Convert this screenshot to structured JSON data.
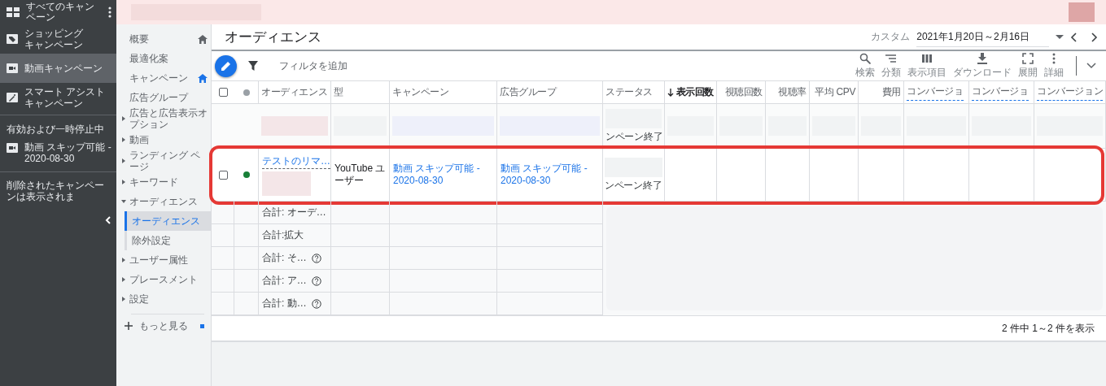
{
  "sidebar": {
    "title": "すべてのキャンペーン",
    "items": [
      {
        "kind": "shopping",
        "lines": [
          "ショッピング",
          "キャンペーン"
        ],
        "selected": false
      },
      {
        "kind": "video",
        "lines": [
          "動画キャンペーン"
        ],
        "selected": true
      },
      {
        "kind": "smart",
        "lines": [
          "スマート アシスト",
          "キャンペーン"
        ],
        "selected": false
      }
    ],
    "section_label": "有効および一時停止中",
    "campaigns": [
      {
        "kind": "video",
        "label": "動画 スキップ可能 - 2020-08-30"
      }
    ],
    "note": "削除されたキャンペーンは表示されま"
  },
  "nav": {
    "items": [
      {
        "label": "概要",
        "home": true,
        "home_active": false,
        "expandable": false
      },
      {
        "label": "最適化案",
        "expandable": false
      },
      {
        "label": "キャンペーン",
        "home": true,
        "home_active": true,
        "expandable": false
      },
      {
        "label": "広告グループ",
        "expandable": false
      },
      {
        "label": "広告と広告表示オプション",
        "expandable": true,
        "expanded": false
      },
      {
        "label": "動画",
        "expandable": true,
        "expanded": false
      },
      {
        "label": "ランディング ページ",
        "expandable": true,
        "expanded": false
      },
      {
        "label": "キーワード",
        "expandable": true,
        "expanded": false
      },
      {
        "label": "オーディエンス",
        "expandable": true,
        "expanded": true,
        "children": [
          {
            "label": "オーディエンス",
            "selected": true
          },
          {
            "label": "除外設定",
            "selected": false
          }
        ]
      },
      {
        "label": "ユーザー属性",
        "expandable": true,
        "expanded": false
      },
      {
        "label": "プレースメント",
        "expandable": true,
        "expanded": false
      },
      {
        "label": "設定",
        "expandable": true,
        "expanded": false
      }
    ],
    "more": "もっと見る"
  },
  "page": {
    "title": "オーディエンス",
    "date_label": "カスタム",
    "date_range": "2021年1月20日～2月16日"
  },
  "toolbar": {
    "filter_placeholder": "フィルタを追加",
    "tools": [
      {
        "kind": "search",
        "label": "検索"
      },
      {
        "kind": "segment",
        "label": "分類"
      },
      {
        "kind": "columns",
        "label": "表示項目"
      },
      {
        "kind": "download",
        "label": "ダウンロード"
      },
      {
        "kind": "expand",
        "label": "展開"
      },
      {
        "kind": "more",
        "label": "詳細"
      }
    ]
  },
  "table": {
    "header_checked": false,
    "columns": [
      {
        "label": "オーディエンス",
        "numeric": false
      },
      {
        "label": "型",
        "numeric": false
      },
      {
        "label": "キャンペーン",
        "numeric": false
      },
      {
        "label": "広告グループ",
        "numeric": false
      },
      {
        "label": "ステータス",
        "numeric": false
      },
      {
        "label": "表示回数",
        "numeric": true,
        "sorted": true
      },
      {
        "label": "視聴回数",
        "numeric": true
      },
      {
        "label": "視聴率",
        "numeric": true
      },
      {
        "label": "平均 CPV",
        "numeric": true
      },
      {
        "label": "費用",
        "numeric": true
      },
      {
        "label": "コンバージョ",
        "numeric": false,
        "tooltip": true
      },
      {
        "label": "コンバージョ",
        "numeric": false,
        "tooltip": true
      },
      {
        "label": "コンバージョン",
        "numeric": false,
        "tooltip": true
      }
    ],
    "rows": [
      {
        "kind": "blurred",
        "highlighted": false,
        "status": "ンペーン終了"
      },
      {
        "kind": "data",
        "highlighted": true,
        "checked": false,
        "color": "#188038",
        "audience": "テストのリマ…",
        "type": "YouTube ユーザー",
        "campaign": "動画 スキップ可能 - 2020-08-30",
        "ad_group": "動画 スキップ可能 - 2020-08-30",
        "status": "ンペーン終了"
      }
    ],
    "totals": [
      {
        "label": "合計: オーデ…",
        "help": false
      },
      {
        "label": "合計:拡大",
        "help": false
      },
      {
        "label": "合計: そ…",
        "help": true
      },
      {
        "label": "合計: ア…",
        "help": true
      },
      {
        "label": "合計: 動…",
        "help": true
      }
    ],
    "pagination": "2 件中 1～2 件を表示"
  }
}
